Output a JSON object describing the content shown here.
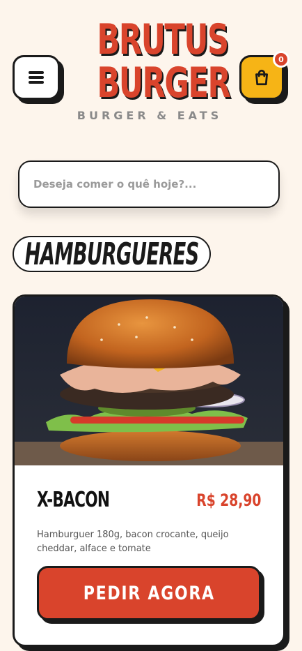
{
  "header": {
    "logo_line1": "BRUTUS",
    "logo_line2": "BURGER",
    "tagline": "BURGER & EATS",
    "menu_icon": "hamburger-menu-icon",
    "cart_icon": "shopping-bag-icon",
    "cart_count": "0"
  },
  "search": {
    "placeholder": "Deseja comer o quê hoje?...",
    "value": ""
  },
  "section": {
    "title": "HAMBURGUERES"
  },
  "product": {
    "image_alt": "burger-photo",
    "name": "X-BACON",
    "price": "R$ 28,90",
    "description": "Hamburguer 180g, bacon crocante, queijo cheddar, alface e tomate",
    "order_label": "PEDIR AGORA"
  },
  "colors": {
    "background": "#fdf5ec",
    "brand_red": "#d9442c",
    "cart_yellow": "#f6b416",
    "outline": "#1a1a1a"
  }
}
